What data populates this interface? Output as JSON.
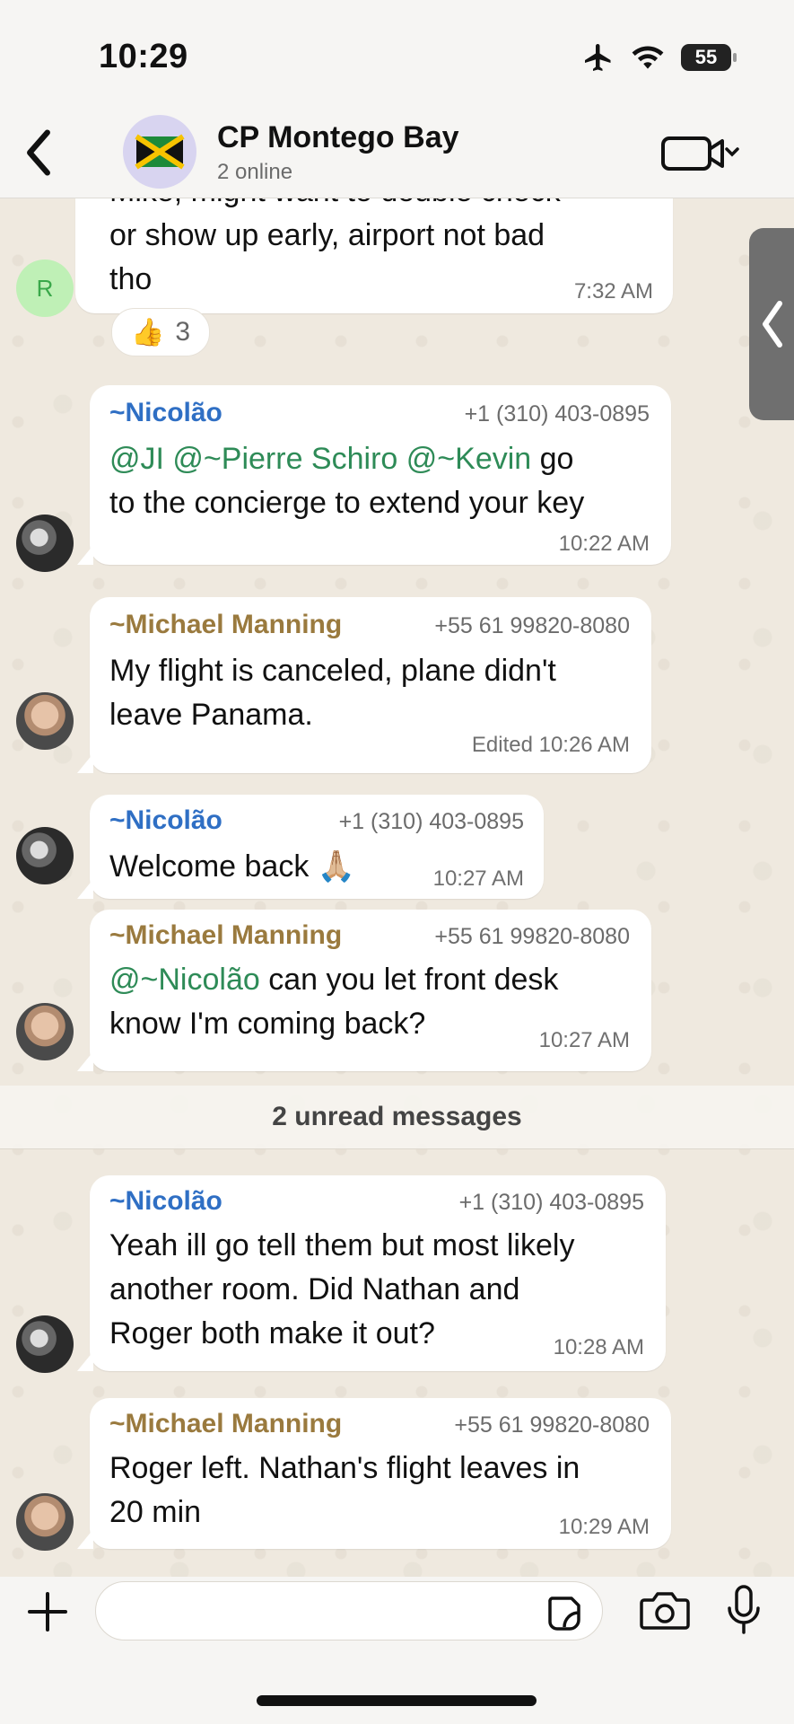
{
  "status_bar": {
    "time": "10:29",
    "battery": "55"
  },
  "header": {
    "title": "CP Montego Bay",
    "subtitle": "2 online"
  },
  "messages": [
    {
      "id": "m0",
      "lines": [
        "Mike, might want to double check",
        "or show up early, airport not bad",
        "tho"
      ],
      "time": "7:32 AM",
      "avatar_letter": "R",
      "reaction": {
        "emoji": "👍",
        "count": "3"
      }
    },
    {
      "id": "m1",
      "sender": "~Nicolão",
      "phone": "+1 (310) 403-0895",
      "mentions": [
        "@JI",
        "@~Pierre Schiro",
        "@~Kevin"
      ],
      "line1_tail": "go",
      "line2": "to the concierge to extend your key",
      "time": "10:22 AM"
    },
    {
      "id": "m2",
      "sender": "~Michael Manning",
      "phone": "+55 61 99820-8080",
      "lines": [
        "My flight is canceled, plane didn't",
        "leave Panama."
      ],
      "time": "Edited 10:26 AM"
    },
    {
      "id": "m3",
      "sender": "~Nicolão",
      "phone": "+1 (310) 403-0895",
      "lines": [
        "Welcome back 🙏🏼"
      ],
      "time": "10:27 AM"
    },
    {
      "id": "m4",
      "sender": "~Michael Manning",
      "phone": "+55 61 99820-8080",
      "mention": "@~Nicolão",
      "line1_tail": "can you let front desk",
      "line2": "know I'm coming back?",
      "time": "10:27 AM"
    },
    {
      "id": "m5",
      "sender": "~Nicolão",
      "phone": "+1 (310) 403-0895",
      "lines": [
        "Yeah ill go tell them but most likely",
        "another room. Did Nathan and",
        "Roger both make it out?"
      ],
      "time": "10:28 AM"
    },
    {
      "id": "m6",
      "sender": "~Michael Manning",
      "phone": "+55 61 99820-8080",
      "lines": [
        "Roger left. Nathan's flight leaves in",
        "20 min"
      ],
      "time": "10:29 AM"
    }
  ],
  "unread_label": "2 unread messages",
  "composer": {
    "placeholder": ""
  },
  "colors": {
    "nicolao": "#2f6fc4",
    "michael": "#9a7a3e",
    "mention": "#2e8b57",
    "background": "#efeae2"
  },
  "icons": [
    "airplane-icon",
    "wifi-icon",
    "battery-icon",
    "back-chevron-icon",
    "jamaica-flag-icon",
    "video-call-icon",
    "drawer-chevron-icon",
    "plus-icon",
    "sticker-icon",
    "camera-icon",
    "microphone-icon"
  ]
}
